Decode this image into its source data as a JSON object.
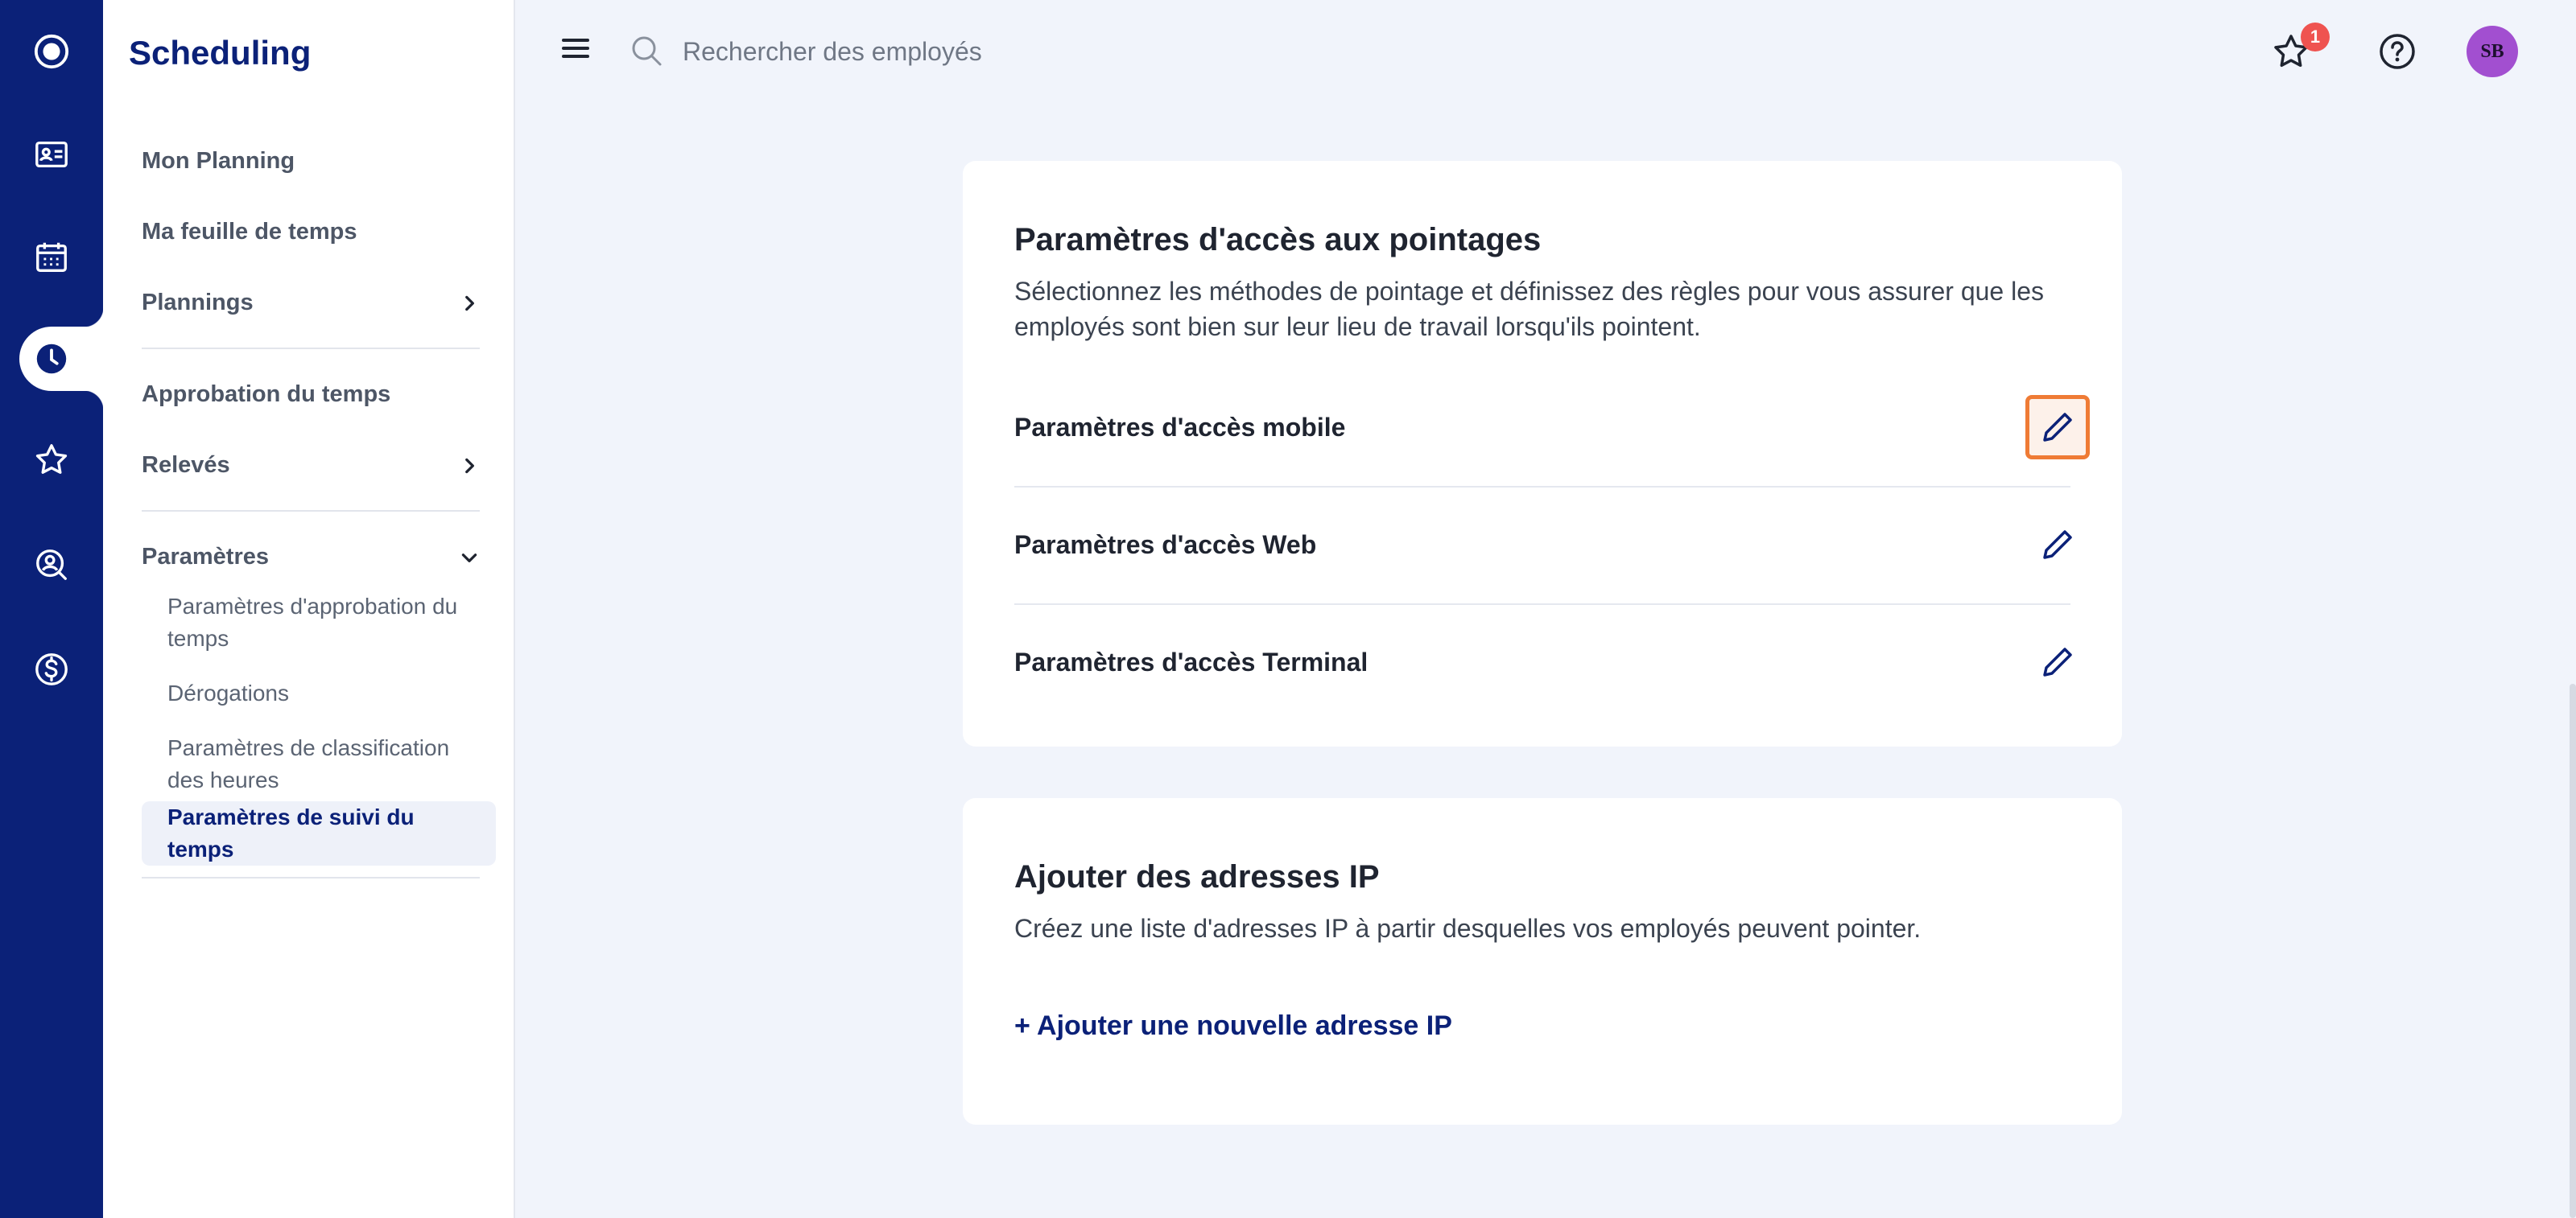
{
  "app": {
    "title": "Scheduling"
  },
  "rail": {
    "items": [
      "app-logo-icon",
      "id-card-icon",
      "calendar-icon",
      "clock-icon",
      "star-icon",
      "search-person-icon",
      "dollar-icon"
    ],
    "active": "clock-icon"
  },
  "sidenav": {
    "items": [
      {
        "label": "Mon Planning"
      },
      {
        "label": "Ma feuille de temps"
      },
      {
        "label": "Plannings"
      },
      {
        "label": "Approbation du temps"
      },
      {
        "label": "Relevés"
      },
      {
        "label": "Paramètres"
      }
    ],
    "sub_items": [
      {
        "label": "Paramètres d'approbation du temps"
      },
      {
        "label": "Dérogations"
      },
      {
        "label": "Paramètres de classification des heures"
      },
      {
        "label": "Paramètres de suivi du temps"
      }
    ]
  },
  "header": {
    "search_placeholder": "Rechercher des employés",
    "notification_count": "1",
    "avatar_initials": "SB"
  },
  "card_access": {
    "title": "Paramètres d'accès aux pointages",
    "description": "Sélectionnez les méthodes de pointage et définissez des règles pour vous assurer que les employés sont bien sur leur lieu de travail lorsqu'ils pointent.",
    "rows": [
      {
        "label": "Paramètres d'accès mobile"
      },
      {
        "label": "Paramètres d'accès Web"
      },
      {
        "label": "Paramètres d'accès Terminal"
      }
    ]
  },
  "card_ip": {
    "title": "Ajouter des adresses IP",
    "description": "Créez une liste d'adresses IP à partir desquelles vos employés peuvent pointer.",
    "add_link": "+ Ajouter une nouvelle adresse IP"
  },
  "colors": {
    "navy": "#0b2178",
    "accent_focus": "#ef7b35",
    "avatar": "#a24fd0",
    "badge": "#ef5350"
  }
}
